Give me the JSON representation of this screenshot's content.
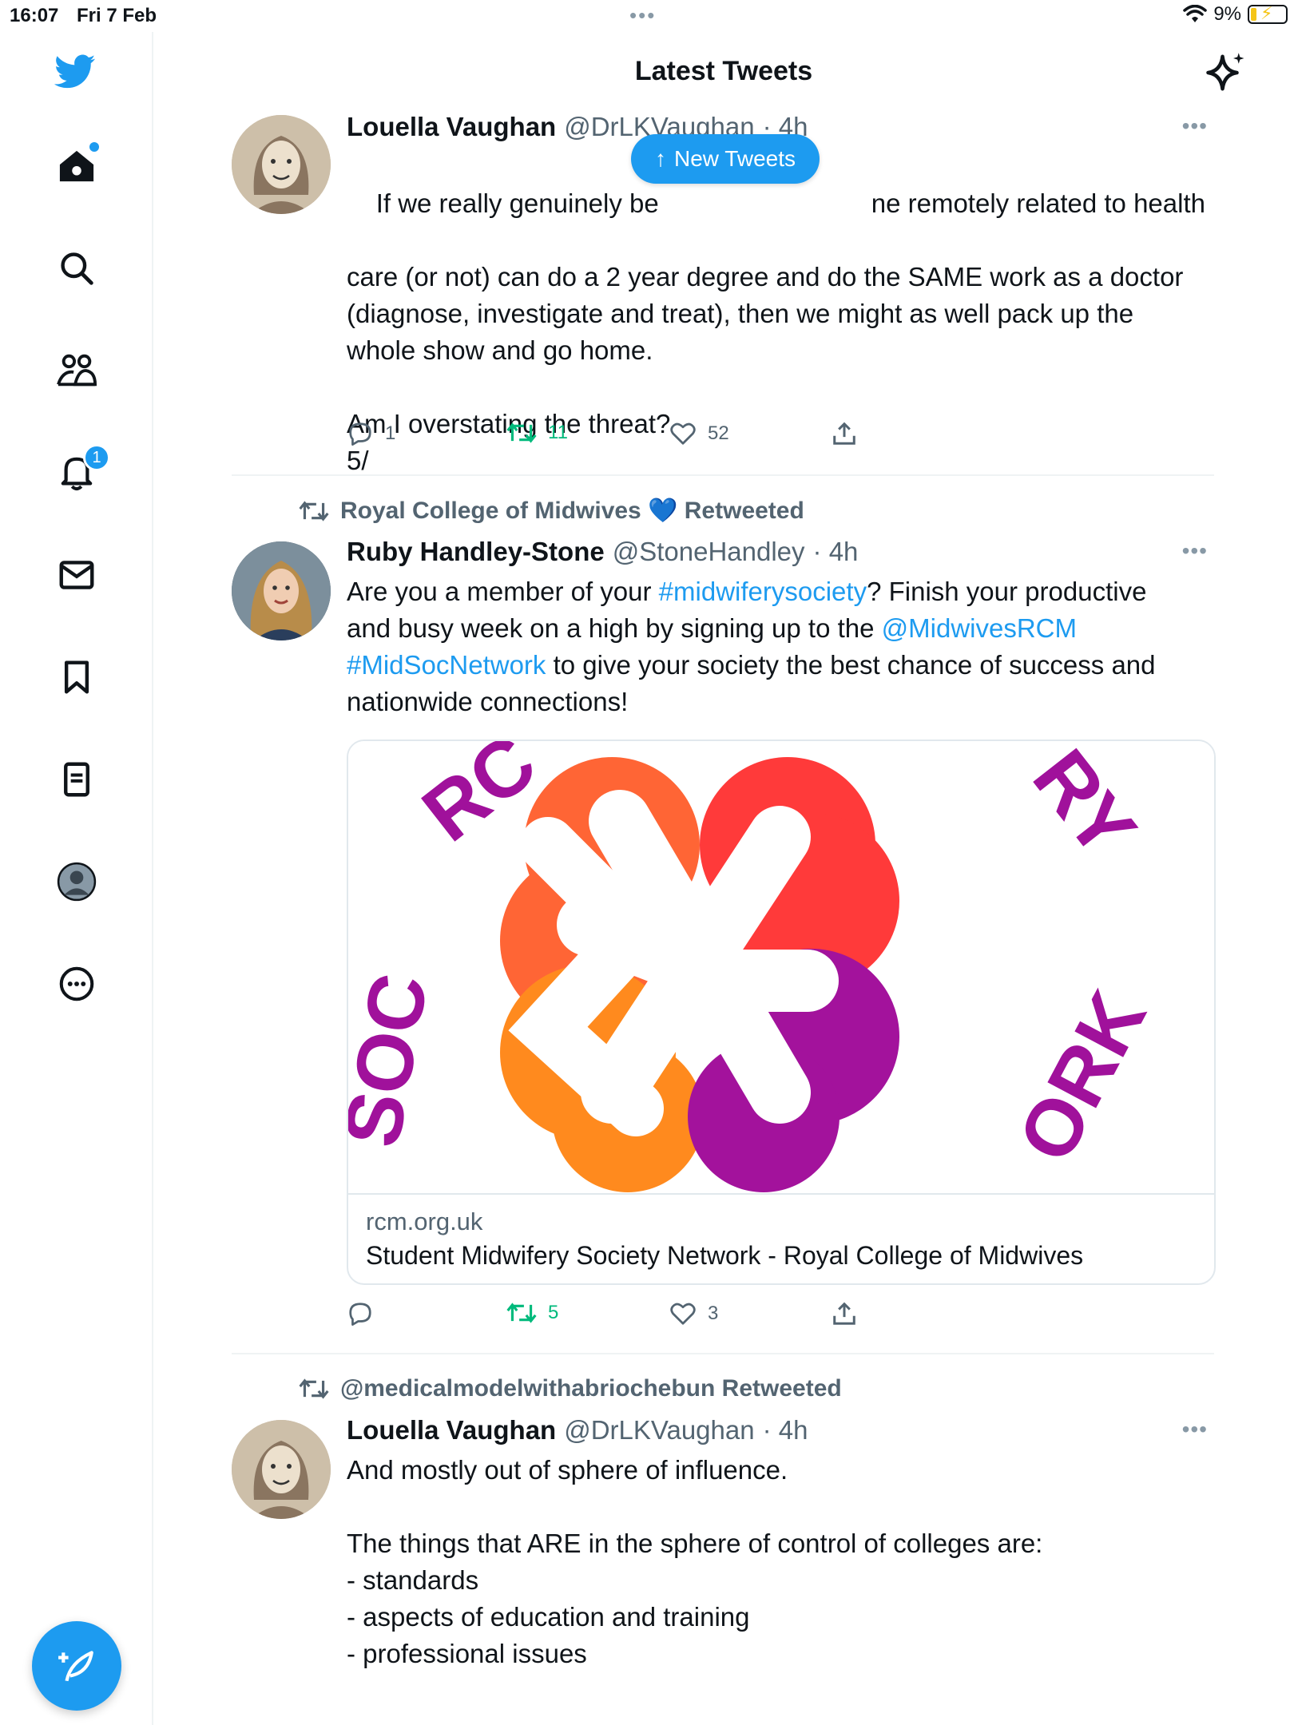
{
  "status": {
    "time": "16:07",
    "date": "Fri 7 Feb",
    "battery": "9%"
  },
  "header": {
    "title": "Latest Tweets"
  },
  "new_tweets_label": "New Tweets",
  "nav": {
    "notifications_count": "1"
  },
  "tweets": [
    {
      "name": "Louella Vaughan",
      "handle": "@DrLKVaughan",
      "time": "· 4h",
      "text_line1_start": "If we really genuinely be",
      "text_line1_end": "ne remotely related to health",
      "text_rest": "care (or not) can do a 2 year degree and do the SAME work as a doctor\n(diagnose, investigate and treat), then we might as well pack up the\nwhole show and go home.\n\nAm I overstating the threat?\n5/",
      "replies": "1",
      "retweets": "11",
      "likes": "52"
    },
    {
      "retweeted_by": "Royal College of Midwives 💙 Retweeted",
      "name": "Ruby Handley-Stone",
      "handle": "@StoneHandley",
      "time": "· 4h",
      "t1": "Are you a member of your ",
      "t2": "#midwiferysociety",
      "t3": "? Finish your productive\nand busy week on a high by signing up to the ",
      "t4": "@MidwivesRCM",
      "t5": "\n",
      "t6": "#MidSocNetwork",
      "t7": " to give your society the best chance of success and\nnationwide connections!",
      "card": {
        "domain": "rcm.org.uk",
        "title": "Student Midwifery Society Network - Royal College of Midwives",
        "image_text_tl": "RC",
        "image_text_tr": "RY",
        "image_text_bl": "SOC",
        "image_text_br": "ORK"
      },
      "replies": "",
      "retweets": "5",
      "likes": "3"
    },
    {
      "retweeted_by": "@medicalmodelwithabriochebun Retweeted",
      "name": "Louella Vaughan",
      "handle": "@DrLKVaughan",
      "time": "· 4h",
      "text": "And mostly out of sphere of influence.\n\nThe things that ARE in the sphere of control of colleges are:\n- standards\n- aspects of education and training\n- professional issues"
    }
  ],
  "colors": {
    "accent": "#1d9bf0",
    "retweet_green": "#00ba7c",
    "muted": "#536471"
  },
  "icons": [
    "twitter-bird-icon",
    "home-icon",
    "search-icon",
    "communities-icon",
    "notifications-icon",
    "messages-icon",
    "bookmarks-icon",
    "lists-icon",
    "profile-icon",
    "more-icon",
    "compose-icon",
    "sparkle-icon",
    "reply-icon",
    "retweet-icon",
    "like-icon",
    "share-icon"
  ]
}
